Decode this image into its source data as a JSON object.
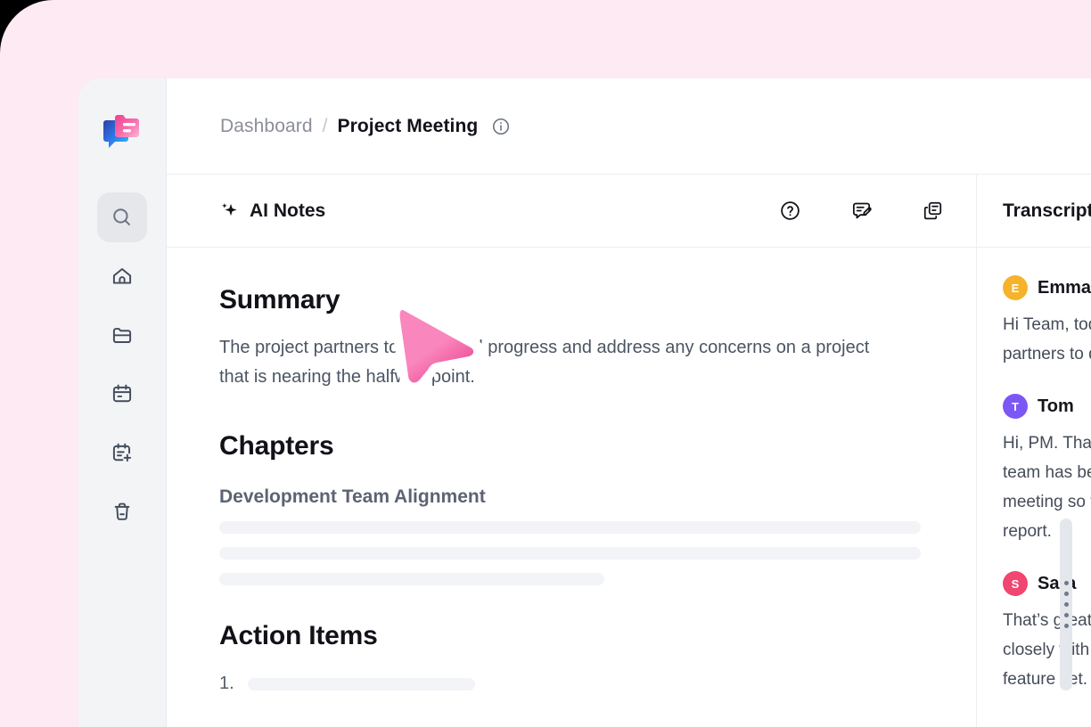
{
  "window": {
    "background_color": "#fdeaf3",
    "surface_color": "#ffffff"
  },
  "sidebar": {
    "logo_name": "app-logo",
    "items": [
      {
        "id": "search",
        "icon": "search-icon",
        "label": "Search",
        "active": true
      },
      {
        "id": "home",
        "icon": "home-icon",
        "label": "Home",
        "active": false
      },
      {
        "id": "folders",
        "icon": "folder-icon",
        "label": "Folders",
        "active": false
      },
      {
        "id": "calendar",
        "icon": "calendar-icon",
        "label": "Calendar",
        "active": false
      },
      {
        "id": "new-note",
        "icon": "calendar-plus-icon",
        "label": "New Note",
        "active": false
      },
      {
        "id": "trash",
        "icon": "trash-icon",
        "label": "Trash",
        "active": false
      }
    ]
  },
  "breadcrumb": {
    "parent": "Dashboard",
    "separator": "/",
    "current": "Project Meeting",
    "info_icon": "info-circle-icon"
  },
  "notes_panel": {
    "title": "AI Notes",
    "title_icon": "sparkle-icon",
    "actions": [
      {
        "id": "help",
        "icon": "help-circle-icon",
        "label": "Help"
      },
      {
        "id": "feedback",
        "icon": "message-edit-icon",
        "label": "Feedback"
      },
      {
        "id": "copy",
        "icon": "copy-icon",
        "label": "Copy"
      }
    ],
    "summary": {
      "heading": "Summary",
      "text": "The project partners to discussed progress and address any concerns on a project that is nearing the halfway point."
    },
    "chapters": {
      "heading": "Chapters",
      "items": [
        {
          "title": "Development Team Alignment",
          "placeholder_lines": 3
        }
      ]
    },
    "action_items": {
      "heading": "Action Items",
      "items": [
        {
          "number": "1."
        }
      ]
    }
  },
  "resizer": {
    "name": "pane-resize-handle",
    "dots": 5
  },
  "transcript_panel": {
    "title": "Transcript",
    "messages": [
      {
        "initial": "E",
        "name": "Emma",
        "avatar_color": "#f5b32c",
        "text": "Hi Team, today we will be meeting with our\npartners to discuss the project status."
      },
      {
        "initial": "T",
        "name": "Tom",
        "avatar_color": "#7c57f5",
        "text": "Hi, PM. Thanks for setting this up. Our\nteam has been looking forward to this\nmeeting so that we can share our progress\nreport."
      },
      {
        "initial": "S",
        "name": "Sara",
        "avatar_color": "#f0466f",
        "text": "That’s great to hear. We have been working\nclosely with the dev team on the new\nfeature set."
      }
    ]
  },
  "cursor": {
    "name": "mouse-cursor",
    "color_from": "#f986bd",
    "color_to": "#ea3f8c"
  }
}
